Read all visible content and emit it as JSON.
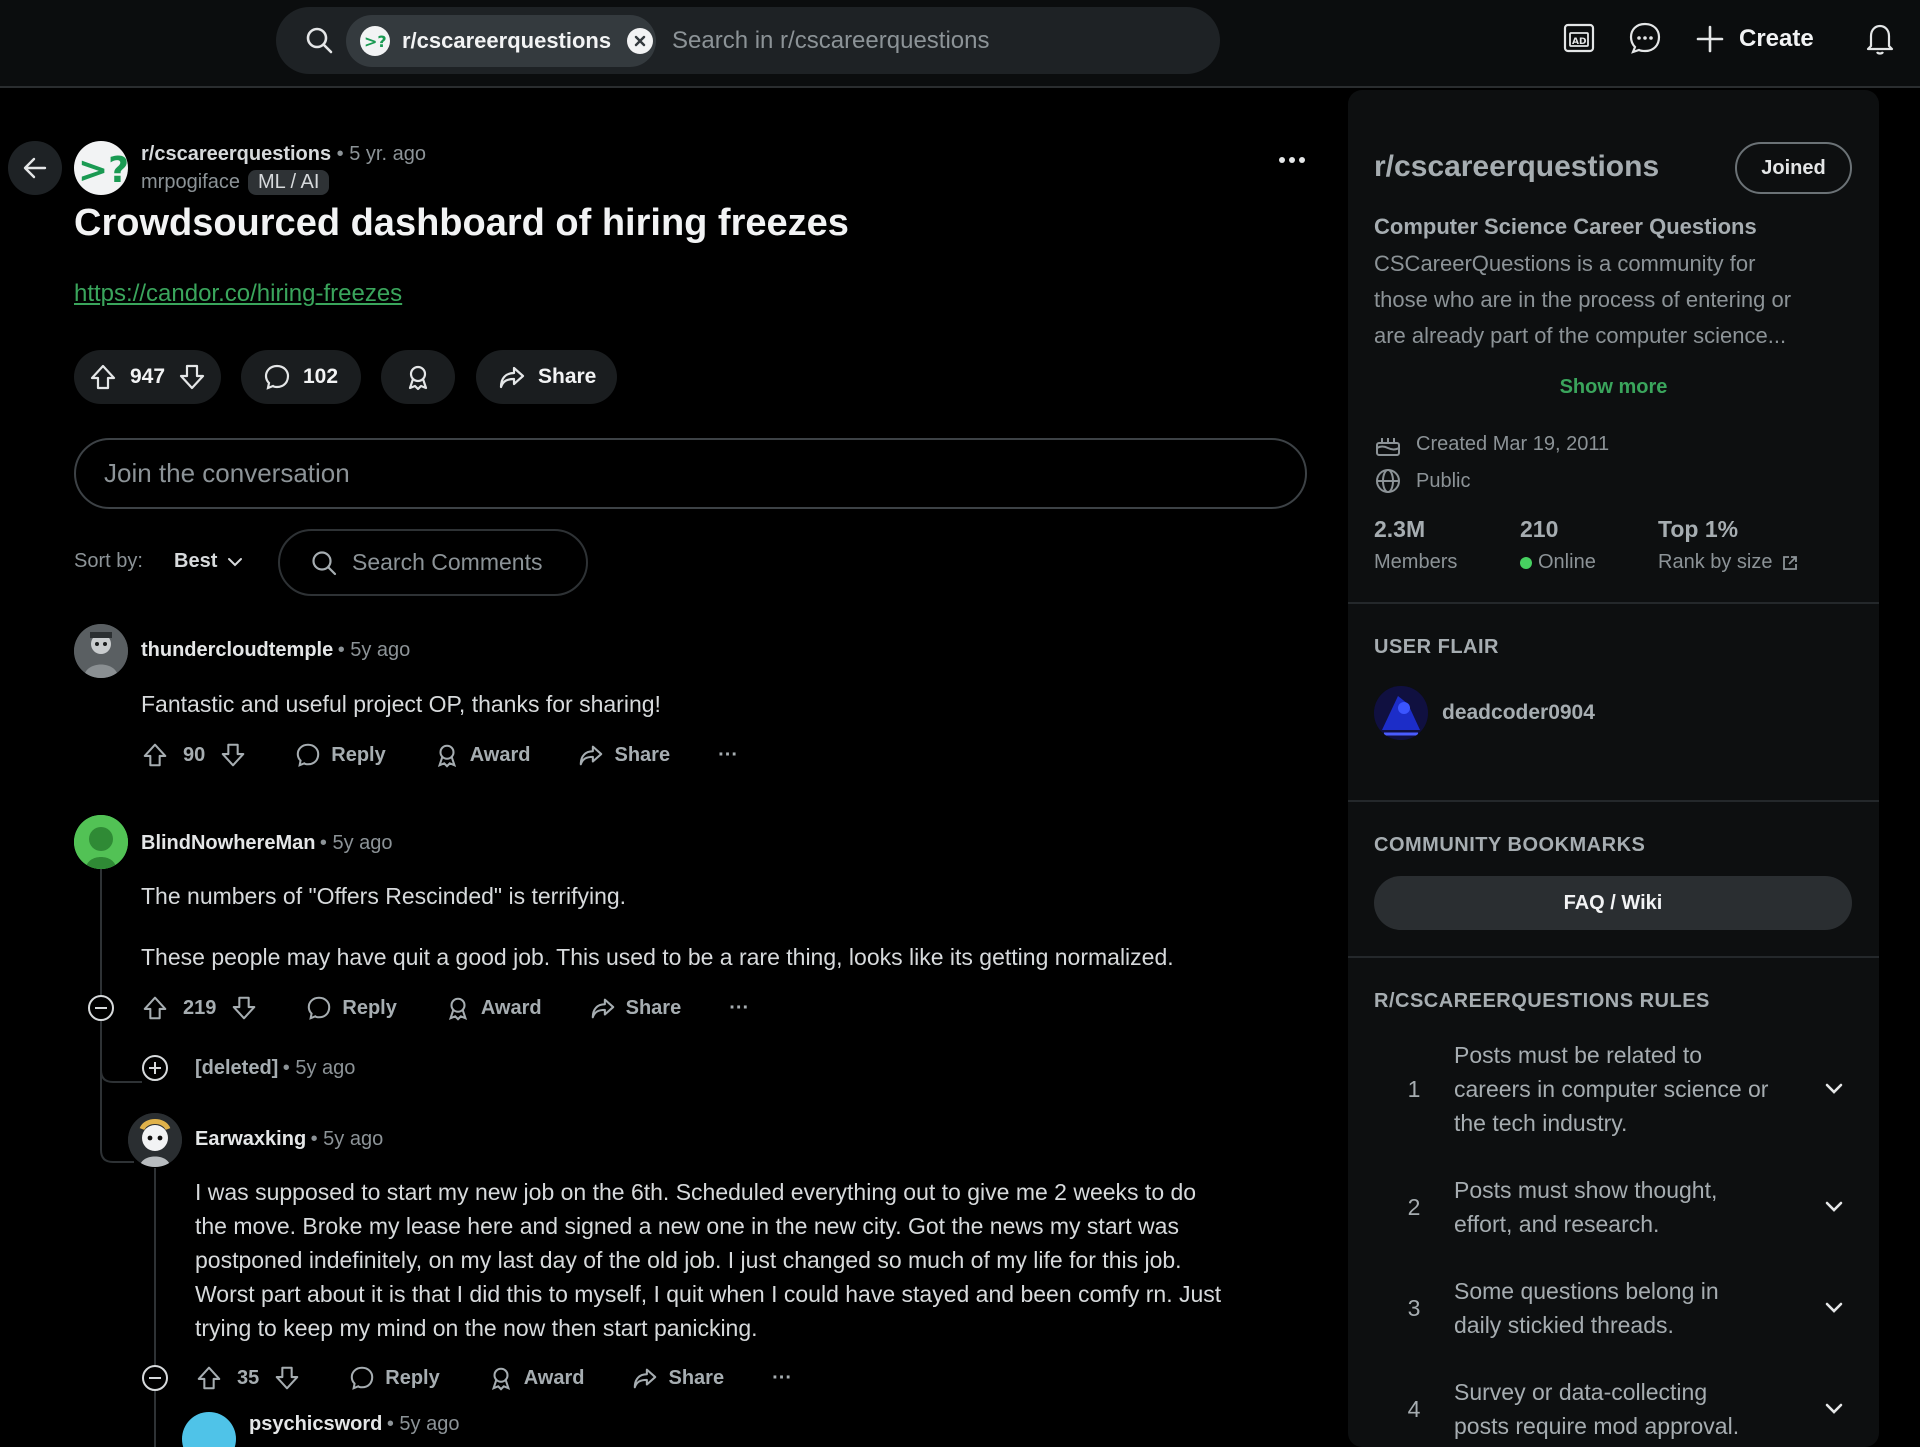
{
  "header": {
    "search_chip_label": "r/cscareerquestions",
    "search_placeholder": "Search in r/cscareerquestions",
    "create_label": "Create",
    "icons": [
      "search-icon",
      "ad-icon",
      "chat-icon",
      "plus-icon",
      "bell-icon"
    ]
  },
  "post": {
    "subreddit": "r/cscareerquestions",
    "age": "• 5 yr. ago",
    "author": "mrpogiface",
    "flair": "ML / AI",
    "title": "Crowdsourced dashboard of hiring freezes",
    "link": "https://candor.co/hiring-freezes",
    "votes": "947",
    "comments": "102",
    "share_label": "Share"
  },
  "conversation": {
    "placeholder": "Join the conversation",
    "sort_label": "Sort by:",
    "sort_value": "Best",
    "search_comments": "Search Comments"
  },
  "comments": [
    {
      "author": "thundercloudtemple",
      "time": "• 5y ago",
      "body": [
        "Fantastic and useful project OP, thanks for sharing!"
      ],
      "votes": "90"
    },
    {
      "author": "BlindNowhereMan",
      "time": "• 5y ago",
      "body": [
        "The numbers of \"Offers Rescinded\" is terrifying.",
        "These people may have quit a good job. This used to be a rare thing, looks like its getting normalized."
      ],
      "votes": "219"
    },
    {
      "author": "[deleted]",
      "time": "• 5y ago"
    },
    {
      "author": "Earwaxking",
      "time": "• 5y ago",
      "body": [
        "I was supposed to start my new job on the 6th. Scheduled everything out to give me 2 weeks to do",
        "the move. Broke my lease here and signed a new one in the new city. Got the news my start was",
        "postponed indefinitely, on my last day of the old job. I just changed so much of my life for this job.",
        "Worst part about it is that I did this to myself, I quit when I could have stayed and been comfy rn. Just",
        "trying to keep my mind on the now then start panicking."
      ],
      "votes": "35"
    },
    {
      "author": "psychicsword",
      "time": "• 5y ago"
    }
  ],
  "actions": {
    "reply": "Reply",
    "award": "Award",
    "share": "Share",
    "more": "···"
  },
  "sidebar": {
    "name": "r/cscareerquestions",
    "joined_label": "Joined",
    "subtitle": "Computer Science Career Questions",
    "description": [
      "CSCareerQuestions is a community for",
      "those who are in the process of entering or",
      "are already part of the computer science..."
    ],
    "show_more": "Show more",
    "created": "Created Mar 19, 2011",
    "visibility": "Public",
    "stats": [
      {
        "value": "2.3M",
        "label": "Members"
      },
      {
        "value": "210",
        "label": "Online"
      },
      {
        "value": "Top 1%",
        "label": "Rank by size"
      }
    ],
    "user_flair_heading": "USER FLAIR",
    "user_flair_name": "deadcoder0904",
    "bookmarks_heading": "COMMUNITY BOOKMARKS",
    "bookmark_button": "FAQ / Wiki",
    "rules_heading": "R/CSCAREERQUESTIONS RULES",
    "rules": [
      {
        "num": "1",
        "lines": [
          "Posts must be related to",
          "careers in computer science or",
          "the tech industry."
        ]
      },
      {
        "num": "2",
        "lines": [
          "Posts must show thought,",
          "effort, and research."
        ]
      },
      {
        "num": "3",
        "lines": [
          "Some questions belong in",
          "daily stickied threads."
        ]
      },
      {
        "num": "4",
        "lines": [
          "Survey or data-collecting",
          "posts require mod approval."
        ]
      }
    ]
  },
  "colors": {
    "accent_green": "#3aa55c",
    "online_dot": "#46d160",
    "background": "#000000"
  }
}
